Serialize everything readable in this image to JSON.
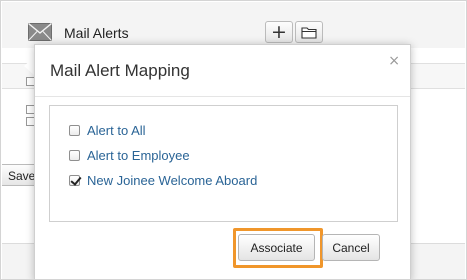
{
  "background": {
    "section_title": "Mail Alerts",
    "add_button_label": "+",
    "save_button_label": "Save"
  },
  "modal": {
    "title": "Mail Alert Mapping",
    "close_symbol": "×",
    "options": [
      {
        "label": "Alert to All",
        "checked": false
      },
      {
        "label": "Alert to Employee",
        "checked": false
      },
      {
        "label": "New Joinee Welcome Aboard",
        "checked": true
      }
    ],
    "associate_label": "Associate",
    "cancel_label": "Cancel"
  },
  "colors": {
    "option_text": "#2a6496",
    "highlight_border": "#f0962b"
  },
  "icons": {
    "mail": "envelope-icon",
    "folder": "folder-icon",
    "close": "close-icon"
  }
}
